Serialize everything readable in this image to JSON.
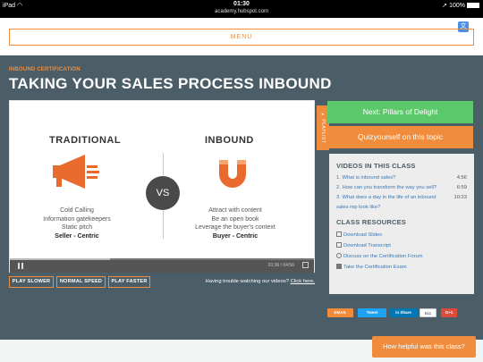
{
  "statusbar": {
    "device": "iPad",
    "wifi_icon": "wifi-icon",
    "time": "01:30",
    "url": "academy.hubspot.com",
    "battery": "100%"
  },
  "header": {
    "menu_label": "MENU"
  },
  "hero": {
    "kicker": "INBOUND CERTIFICATION",
    "title": "TAKING YOUR SALES PROCESS INBOUND"
  },
  "slide": {
    "left_heading": "TRADITIONAL",
    "right_heading": "INBOUND",
    "vs": "VS",
    "left_items": [
      "Cold Calling",
      "Information gatekeepers",
      "Static pitch",
      "Seller - Centric"
    ],
    "right_items": [
      "Attract with content",
      "Be an open book",
      "Leverage the buyer's context",
      "Buyer - Centric"
    ],
    "time": "01:36 / 04:56",
    "progress": 0.33
  },
  "controls": {
    "play_slower": "PLAY SLOWER",
    "normal_speed": "NORMAL SPEED",
    "play_faster": "PLAY FASTER",
    "trouble_text": "Having trouble watching our videos?",
    "trouble_link": "Click here."
  },
  "playlist_tab": "PLAYLIST",
  "sidebar": {
    "next_button": "Next: Pillars of Delight",
    "quiz_button": "Quizyourself on this topic",
    "videos_heading": "VIDEOS IN THIS CLASS",
    "videos": [
      {
        "num": "1.",
        "title": "What is inbound sales?",
        "duration": "4:56"
      },
      {
        "num": "2.",
        "title": "How can you transform the way you sell?",
        "duration": "6:59"
      },
      {
        "num": "3.",
        "title": "What does a day in the life of an inbound sales rep look like?",
        "duration": "10:23"
      }
    ],
    "resources_heading": "CLASS RESOURCES",
    "resources": [
      {
        "label": "Download Slides",
        "icon": "document-icon"
      },
      {
        "label": "Download Transcript",
        "icon": "document-icon"
      },
      {
        "label": "Discuss on the Certification Forum",
        "icon": "chat-bubble-icon"
      },
      {
        "label": "Take the Certification Exam",
        "icon": "checkbox-icon"
      }
    ]
  },
  "share": {
    "email": "EMAIL",
    "tweet": "Tweet",
    "linkedin": "Share",
    "count": "511",
    "gplus": "G+1"
  },
  "feedback_button": "How helpful was this class?",
  "colors": {
    "accent": "#f08c3c",
    "hero_bg": "#4b5d67",
    "next_green": "#5bc86a",
    "link_blue": "#3a78b8"
  }
}
